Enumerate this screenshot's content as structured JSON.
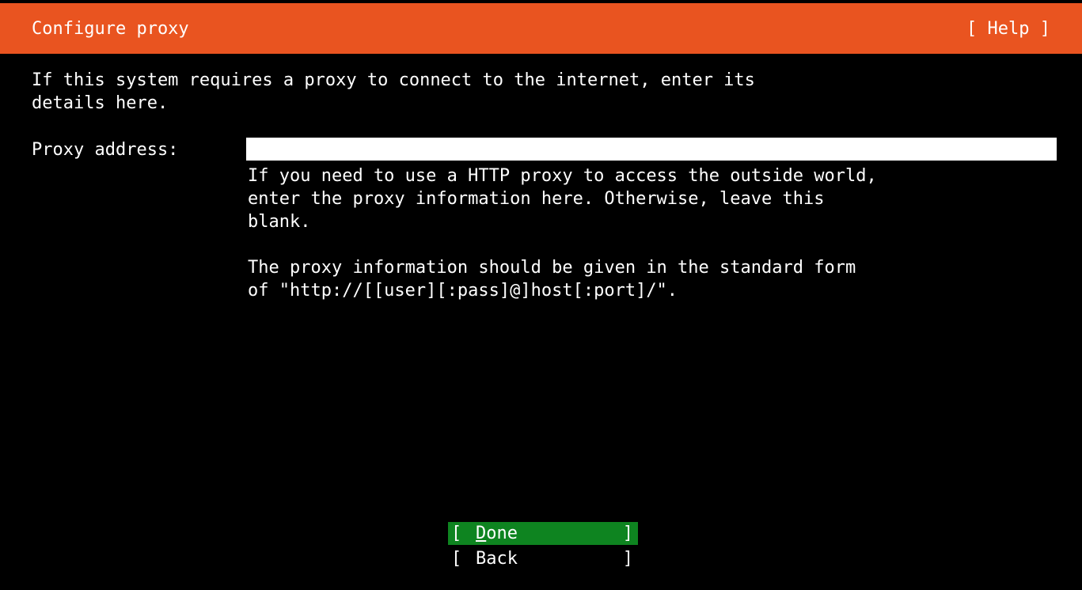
{
  "header": {
    "title": "Configure proxy",
    "help": "[ Help ]",
    "color": "#e95420"
  },
  "intro": "If this system requires a proxy to connect to the internet, enter its\ndetails here.",
  "proxy": {
    "label": "Proxy address:",
    "value": "",
    "help_1": "If you need to use a HTTP proxy to access the outside world,\nenter the proxy information here. Otherwise, leave this\nblank.",
    "help_2": "The proxy information should be given in the standard form\nof \"http://[[user][:pass]@]host[:port]/\"."
  },
  "buttons": {
    "done": {
      "open": "[",
      "hotkey": "D",
      "rest": "one",
      "close": "]",
      "color": "#0e8420"
    },
    "back": {
      "open": "[",
      "label": "Back",
      "close": "]"
    }
  }
}
